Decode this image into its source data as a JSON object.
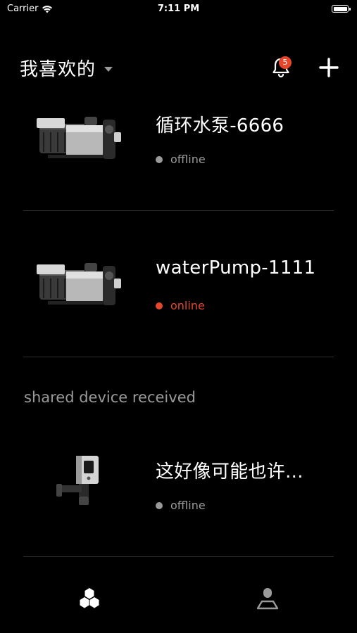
{
  "status_bar": {
    "carrier": "Carrier",
    "time": "7:11 PM"
  },
  "header": {
    "home_name": "我喜欢的",
    "notification_count": "5"
  },
  "devices": [
    {
      "name": "循环水泵-6666",
      "status": "offline",
      "status_color": "#9a9a9a",
      "image": "pool-pump-icon"
    },
    {
      "name": "waterPump-1111",
      "status": "online",
      "status_color": "#e5472c",
      "image": "pool-pump-icon"
    }
  ],
  "shared_section": {
    "label": "shared device received",
    "devices": [
      {
        "name": "这好像可能也许...",
        "status": "offline",
        "status_color": "#9a9a9a",
        "image": "wall-heat-pump-icon"
      }
    ]
  },
  "tab_bar": {
    "tabs": [
      {
        "name": "devices",
        "icon": "devices-icon",
        "active": true
      },
      {
        "name": "profile",
        "icon": "user-icon",
        "active": false
      }
    ]
  },
  "colors": {
    "background": "#000000",
    "online": "#e5472c",
    "offline": "#9a9a9a",
    "divider": "#2e2e2e"
  }
}
